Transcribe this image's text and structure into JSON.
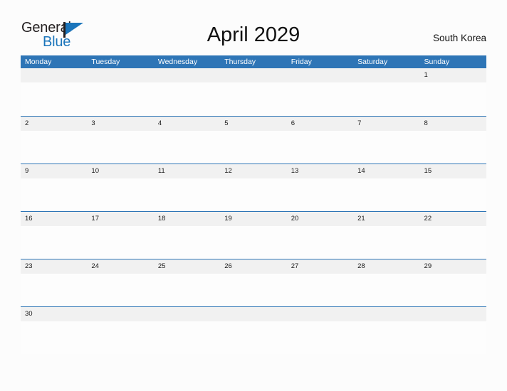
{
  "brand": {
    "name_part1": "General",
    "name_part2": "Blue",
    "flag_icon": "flag-triangle-icon",
    "color_dark": "#231f20",
    "color_blue": "#1b75bb"
  },
  "header": {
    "title": "April 2029",
    "region": "South Korea"
  },
  "theme": {
    "header_blue": "#2e75b6",
    "row_divider_blue": "#2e75b6",
    "date_band_gray": "#f1f1f1",
    "page_background": "#fcfcfc",
    "text_dark": "#1a1a1a",
    "header_text": "#ffffff"
  },
  "calendar": {
    "month": "April",
    "year": "2029",
    "week_start": "Monday",
    "weekdays": [
      "Monday",
      "Tuesday",
      "Wednesday",
      "Thursday",
      "Friday",
      "Saturday",
      "Sunday"
    ],
    "weeks": [
      [
        "",
        "",
        "",
        "",
        "",
        "",
        "1"
      ],
      [
        "2",
        "3",
        "4",
        "5",
        "6",
        "7",
        "8"
      ],
      [
        "9",
        "10",
        "11",
        "12",
        "13",
        "14",
        "15"
      ],
      [
        "16",
        "17",
        "18",
        "19",
        "20",
        "21",
        "22"
      ],
      [
        "23",
        "24",
        "25",
        "26",
        "27",
        "28",
        "29"
      ],
      [
        "30",
        "",
        "",
        "",
        "",
        "",
        ""
      ]
    ]
  }
}
